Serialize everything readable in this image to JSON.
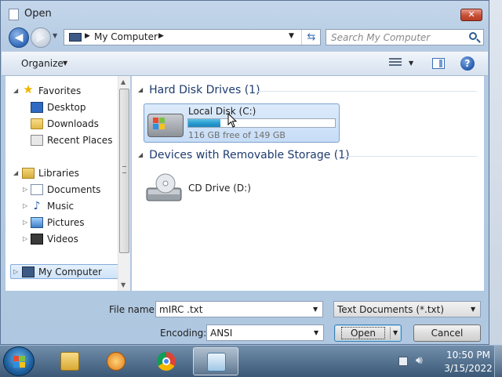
{
  "window": {
    "title": "Open",
    "close_label": "✕"
  },
  "nav": {
    "back_glyph": "◀",
    "forward_glyph": "▶"
  },
  "address": {
    "path": "My Computer"
  },
  "search": {
    "placeholder": "Search My Computer"
  },
  "toolbar": {
    "organize_label": "Organize"
  },
  "sidebar": {
    "favorites": {
      "label": "Favorites",
      "items": [
        {
          "label": "Desktop",
          "icon": "desktop-icon"
        },
        {
          "label": "Downloads",
          "icon": "folder-icon"
        },
        {
          "label": "Recent Places",
          "icon": "recent-places-icon"
        }
      ]
    },
    "libraries": {
      "label": "Libraries",
      "items": [
        {
          "label": "Documents",
          "icon": "documents-icon"
        },
        {
          "label": "Music",
          "icon": "music-icon"
        },
        {
          "label": "Pictures",
          "icon": "pictures-icon"
        },
        {
          "label": "Videos",
          "icon": "videos-icon"
        }
      ]
    },
    "computer": {
      "label": "My Computer",
      "selected": true
    }
  },
  "content": {
    "groups": [
      {
        "header": "Hard Disk Drives (1)",
        "items": [
          {
            "name": "Local Disk (C:)",
            "free_text": "116 GB free of 149 GB",
            "used_fraction": 0.221,
            "selected": true
          }
        ]
      },
      {
        "header": "Devices with Removable Storage (1)",
        "items": [
          {
            "name": "CD Drive (D:)"
          }
        ]
      }
    ]
  },
  "footer": {
    "filename_label": "File name:",
    "filename_value": "mIRC .txt",
    "filetype_value": "Text Documents (*.txt)",
    "encoding_label": "Encoding:",
    "encoding_value": "ANSI",
    "open_label": "Open",
    "cancel_label": "Cancel"
  },
  "taskbar": {
    "apps": [
      {
        "name": "Windows Explorer",
        "icon": "explorer-icon"
      },
      {
        "name": "Windows Media Player",
        "icon": "media-player-icon"
      },
      {
        "name": "Google Chrome",
        "icon": "chrome-icon"
      },
      {
        "name": "Notepad",
        "icon": "notepad-icon",
        "active": true
      }
    ],
    "clock": {
      "time": "10:50 PM",
      "date": "3/15/2022"
    }
  },
  "colors": {
    "accent": "#2f68b8",
    "selection": "#cfe3f8",
    "capacity_bar": "#2a9cd0"
  }
}
